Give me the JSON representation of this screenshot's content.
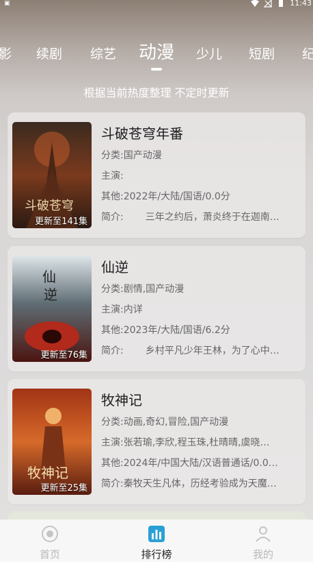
{
  "status": {
    "time": "11:43"
  },
  "tabs": [
    "影",
    "续剧",
    "综艺",
    "动漫",
    "少儿",
    "短剧",
    "纪"
  ],
  "active_tab": "动漫",
  "subtitle": "根据当前热度整理 不定时更新",
  "items": [
    {
      "title": "斗破苍穹年番",
      "badge": "更新至141集",
      "category_label": "分类:",
      "category": "国产动漫",
      "cast_label": "主演:",
      "cast": "",
      "other_label": "其他:",
      "other": "2022年/大陆/国语/0.0分",
      "intro_label": "简介:",
      "intro": "三年之约后，萧炎终于在迦南…",
      "colors": {
        "top": "#3b2a1f",
        "mid": "#7a3a1d",
        "bottom": "#2a1a12",
        "accent": "#d5a04a"
      }
    },
    {
      "title": "仙逆",
      "badge": "更新至76集",
      "category_label": "分类:",
      "category": "剧情,国产动漫",
      "cast_label": "主演:",
      "cast": "内详",
      "other_label": "其他:",
      "other": "2023年/大陆/国语/6.2分",
      "intro_label": "简介:",
      "intro": "乡村平凡少年王林，为了心中…",
      "colors": {
        "top": "#dfe6ea",
        "mid": "#5f6d74",
        "bottom": "#4b1410",
        "accent": "#b12a1c"
      }
    },
    {
      "title": "牧神记",
      "badge": "更新至25集",
      "category_label": "分类:",
      "category": "动画,奇幻,冒险,国产动漫",
      "cast_label": "主演:",
      "cast": "张若瑜,李欣,程玉珠,杜晴晴,虞晓…",
      "other_label": "其他:",
      "other": "2024年/中国大陆/汉语普通话/0.0…",
      "intro_label": "简介:",
      "intro": "秦牧天生凡体，历经考验成为天魔…",
      "colors": {
        "top": "#a33416",
        "mid": "#d66a2a",
        "bottom": "#5a1d10",
        "accent": "#f0b26a"
      }
    }
  ],
  "nav": [
    {
      "label": "首页",
      "icon": "home-icon"
    },
    {
      "label": "排行榜",
      "icon": "ranking-icon"
    },
    {
      "label": "我的",
      "icon": "profile-icon"
    }
  ],
  "accent_nav": "#2a9fd6"
}
